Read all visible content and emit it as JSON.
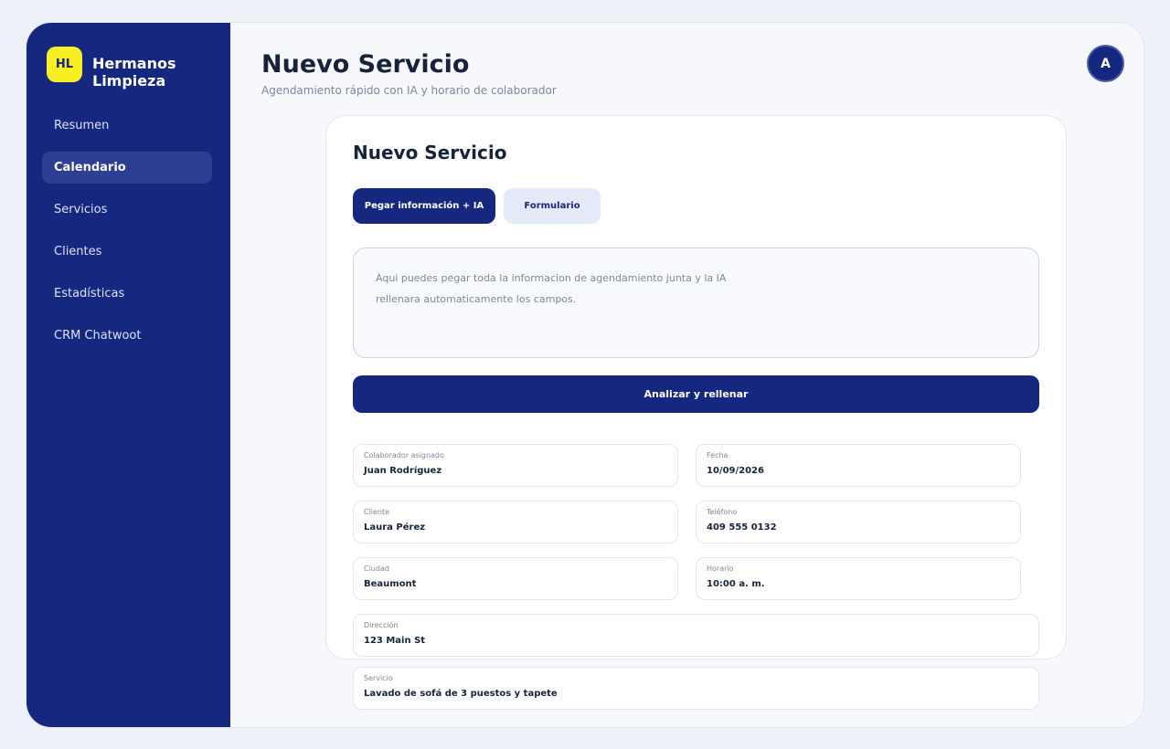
{
  "brand": {
    "logo_text": "HL",
    "name": "Hermanos Limpieza",
    "logo_color": "#f8ee24",
    "primary_color": "#15277f"
  },
  "nav": [
    {
      "label": "Resumen",
      "active": false
    },
    {
      "label": "Calendario",
      "active": true
    },
    {
      "label": "Servicios",
      "active": false
    },
    {
      "label": "Clientes",
      "active": false
    },
    {
      "label": "Estadísticas",
      "active": false
    },
    {
      "label": "CRM Chatwoot",
      "active": false
    }
  ],
  "header": {
    "title": "Nuevo Servicio",
    "subtitle": "Agendamiento rápido con IA y horario de colaborador",
    "avatar_initial": "A"
  },
  "card": {
    "title": "Nuevo Servicio",
    "tabs": [
      {
        "label": "Pegar información + IA",
        "active": true
      },
      {
        "label": "Formulario",
        "active": false
      }
    ],
    "paste_placeholder": "Aqui puedes pegar toda la informacion de agendamiento junta y la IA rellenara automaticamente los campos.",
    "analyze_button": "Analizar y rellenar"
  },
  "form": {
    "collaborator": {
      "label": "Colaborador asignado",
      "value": "Juan Rodríguez"
    },
    "date": {
      "label": "Fecha",
      "value": "10/09/2026"
    },
    "client": {
      "label": "Cliente",
      "value": "Laura Pérez"
    },
    "phone": {
      "label": "Teléfono",
      "value": "409 555 0132"
    },
    "city": {
      "label": "Ciudad",
      "value": "Beaumont"
    },
    "time": {
      "label": "Horario",
      "value": "10:00 a. m."
    },
    "address": {
      "label": "Dirección",
      "value": "123 Main St"
    },
    "service": {
      "label": "Servicio",
      "value": "Lavado de sofá de 3 puestos y tapete"
    }
  }
}
